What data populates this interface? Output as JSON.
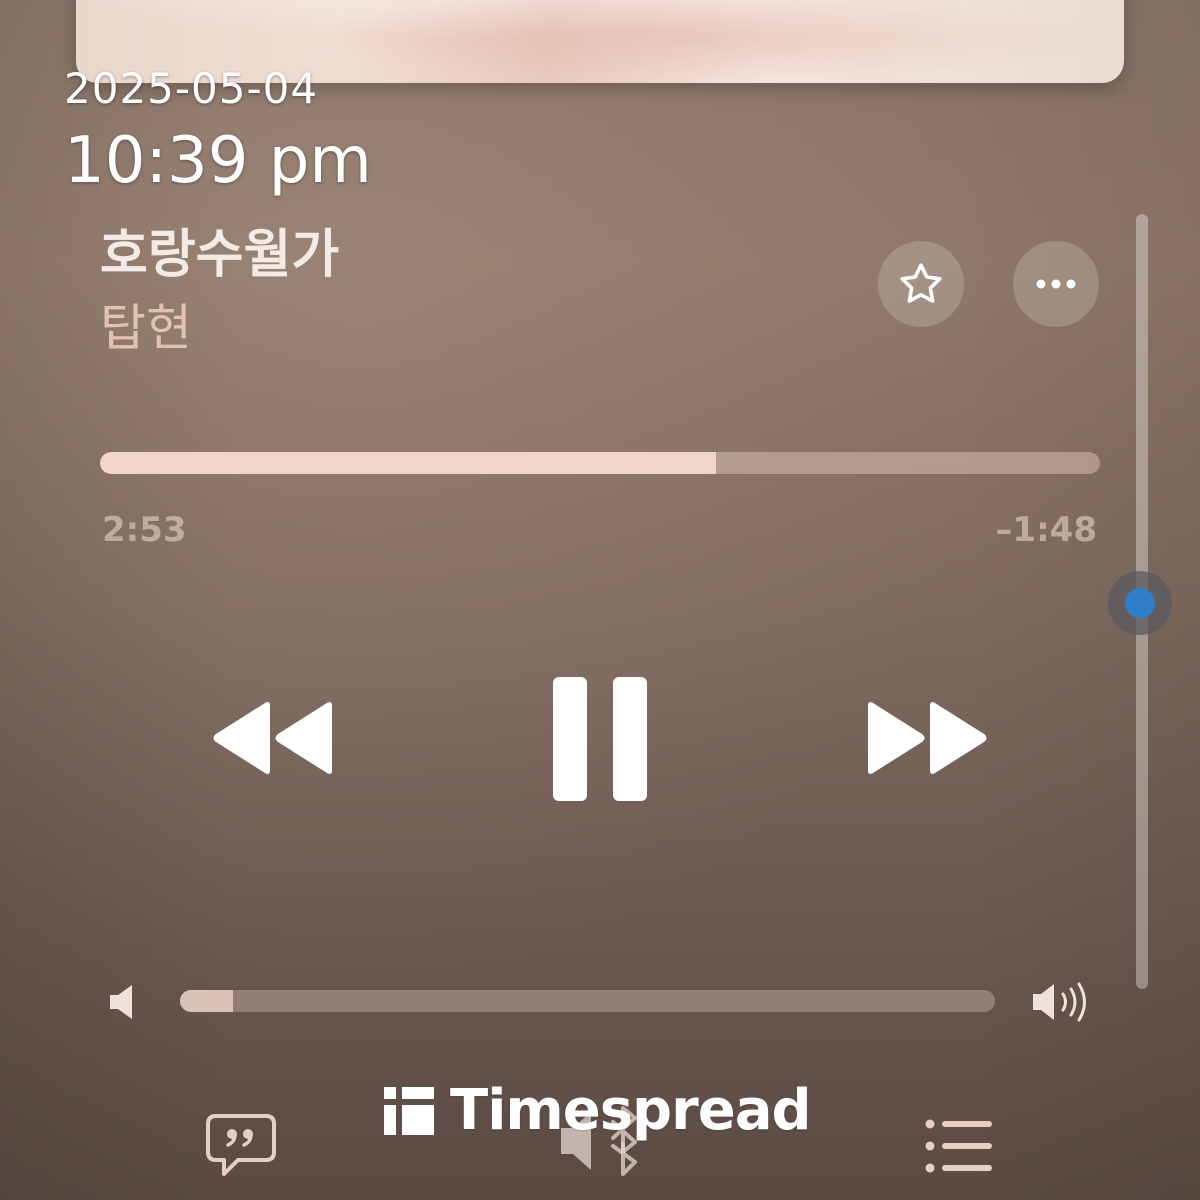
{
  "overlay": {
    "date": "2025-05-04",
    "time": "10:39 pm"
  },
  "track": {
    "title": "호랑수월가",
    "artist": "탑현",
    "elapsed": "2:53",
    "remaining": "–1:48",
    "progress_fraction": 0.616
  },
  "volume": {
    "level_fraction": 0.065
  },
  "icons": {
    "favorite": "star-icon",
    "more": "ellipsis-icon",
    "rewind": "rewind-icon",
    "pause": "pause-icon",
    "forward": "fast-forward-icon",
    "volume_low": "speaker-low-icon",
    "volume_high": "speaker-high-icon",
    "lyrics": "lyrics-quote-icon",
    "airplay": "bluetooth-speaker-icon",
    "queue": "list-icon"
  },
  "colors": {
    "accent": "#f3d4c8",
    "scrubber_dot": "#2f7fc8"
  },
  "watermark": {
    "brand": "Timespread"
  }
}
